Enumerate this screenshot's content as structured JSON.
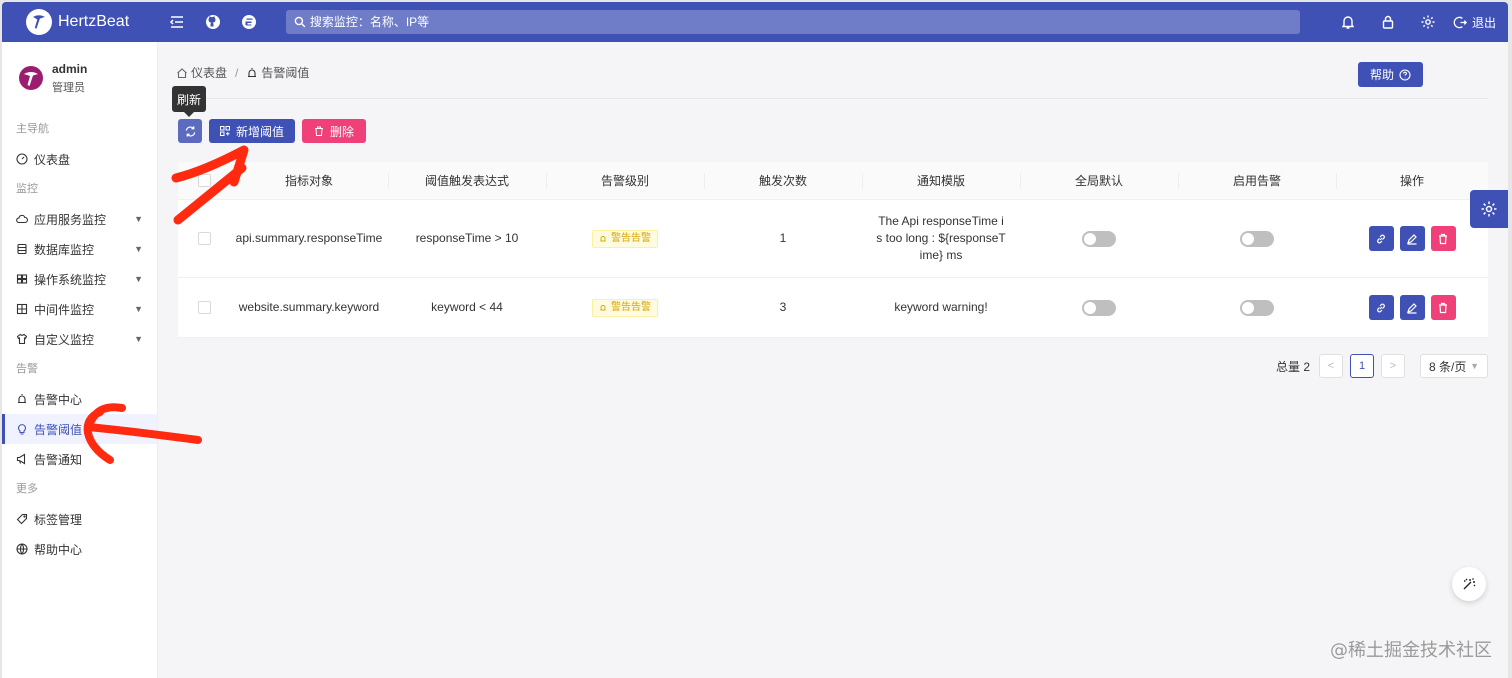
{
  "brand": {
    "name": "HertzBeat"
  },
  "search": {
    "placeholder": "搜索监控：名称、IP等"
  },
  "header": {
    "logout_label": "退出"
  },
  "user": {
    "name": "admin",
    "role": "管理员"
  },
  "sidebar": {
    "groups": {
      "main": "主导航",
      "monitor": "监控",
      "alert": "告警",
      "more": "更多"
    },
    "items": {
      "dashboard": "仪表盘",
      "app_service": "应用服务监控",
      "database": "数据库监控",
      "os": "操作系统监控",
      "middleware": "中间件监控",
      "custom": "自定义监控",
      "alert_center": "告警中心",
      "alert_threshold": "告警阈值",
      "alert_notify": "告警通知",
      "tag_manage": "标签管理",
      "help_center": "帮助中心"
    }
  },
  "breadcrumb": {
    "home": "仪表盘",
    "current": "告警阈值"
  },
  "toolbar": {
    "help_label": "帮助",
    "tooltip": "刷新",
    "add_label": "新增阈值",
    "delete_label": "删除"
  },
  "table": {
    "headers": [
      "指标对象",
      "阈值触发表达式",
      "告警级别",
      "触发次数",
      "通知模版",
      "全局默认",
      "启用告警",
      "操作"
    ],
    "rows": [
      {
        "metric": "api.summary.responseTime",
        "expr": "responseTime > 10",
        "level": "警告告警",
        "times": "1",
        "template": "The Api responseTime is too long : ${responseTime} ms",
        "preset": false,
        "enabled": false
      },
      {
        "metric": "website.summary.keyword",
        "expr": "keyword < 44",
        "level": "警告告警",
        "times": "3",
        "template": "keyword warning!",
        "preset": false,
        "enabled": false
      }
    ]
  },
  "pagination": {
    "total": "总量 2",
    "page": "1",
    "page_size": "8 条/页"
  },
  "watermark": "@稀土掘金技术社区",
  "colors": {
    "primary": "#3f51b5",
    "danger": "#f0407a",
    "warning_tag": "#d4a400",
    "annotation": "#ff2a10"
  }
}
